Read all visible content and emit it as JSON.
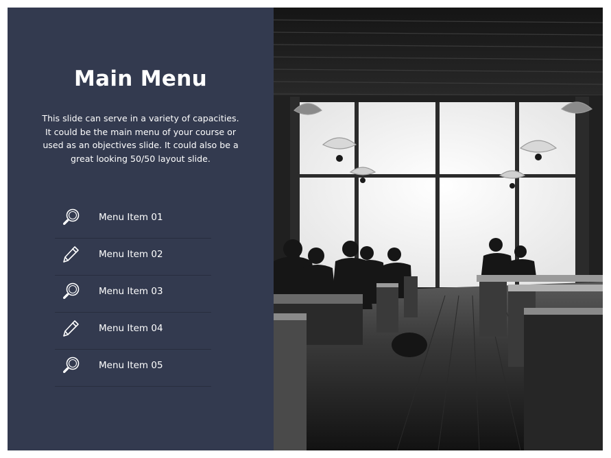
{
  "slide": {
    "title": "Main Menu",
    "description_lines": [
      "This slide can serve in a variety of capacities.",
      "It could be the main menu of your course or",
      "used as an objectives slide.  It could also be a",
      "great looking 50/50 layout slide."
    ]
  },
  "menu": {
    "items": [
      {
        "label": "Menu Item 01",
        "icon": "magnifier-icon"
      },
      {
        "label": "Menu Item 02",
        "icon": "pencil-icon"
      },
      {
        "label": "Menu Item 03",
        "icon": "magnifier-icon"
      },
      {
        "label": "Menu Item 04",
        "icon": "pencil-icon"
      },
      {
        "label": "Menu Item 05",
        "icon": "magnifier-icon"
      }
    ]
  },
  "colors": {
    "panel": "#333a4f",
    "text": "#ffffff"
  }
}
